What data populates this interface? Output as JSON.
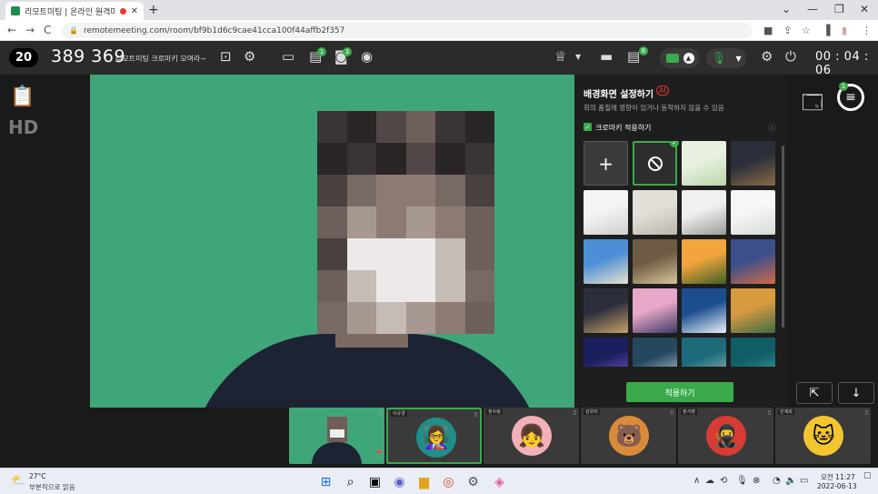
{
  "browser": {
    "tab_title": "리모트미팅 | 온라인 원격미",
    "tab_close": "✕",
    "new_tab": "+",
    "url": "remotemeeting.com/room/bf9b1d6c9cae41cca100f44affb2f357",
    "back": "←",
    "forward": "→",
    "reload": "C"
  },
  "toolbar": {
    "participant_count": "20",
    "room_number": "389 369",
    "room_name": "리모트미팅 크로마키 모여라~",
    "timer": "00 : 04 : 06",
    "badges": {
      "doc": "1",
      "camera": "3",
      "presenter": "6"
    }
  },
  "left_panel": {
    "hd_label": "HD"
  },
  "right_panel": {
    "chat_badge": "1"
  },
  "background_panel": {
    "title": "배경화면 설정하기",
    "ai_badge": "AI",
    "description": "회의 품질에 영향이 있거나 동작하지 않을 수 있음",
    "chroma_key_label": "크로마키 적용하기",
    "chroma_key_checked": true,
    "add_label": "+",
    "apply_button": "적용하기",
    "thumbnails": [
      {
        "type": "add"
      },
      {
        "type": "none",
        "selected": true
      },
      {
        "colors": [
          "#e8f0e2",
          "#b9d6a8"
        ]
      },
      {
        "colors": [
          "#2b2f3a",
          "#8a6a45"
        ]
      },
      {
        "colors": [
          "#f4f4f2",
          "#cfcfcc"
        ]
      },
      {
        "colors": [
          "#e2dfd8",
          "#bcb6aa"
        ]
      },
      {
        "colors": [
          "#f1f0ee",
          "#9a9a98"
        ]
      },
      {
        "colors": [
          "#f6f6f6",
          "#d7dcd8"
        ]
      },
      {
        "colors": [
          "#4d8fd6",
          "#e8e2cf"
        ]
      },
      {
        "colors": [
          "#6e5b43",
          "#d8c49a"
        ]
      },
      {
        "colors": [
          "#f2a53c",
          "#3f5f2a"
        ]
      },
      {
        "colors": [
          "#3b4f8a",
          "#d16a48"
        ]
      },
      {
        "colors": [
          "#2b2f3d",
          "#c7a06a"
        ]
      },
      {
        "colors": [
          "#e7a7c8",
          "#3e3a66"
        ]
      },
      {
        "colors": [
          "#1c4e8f",
          "#e8f1f7"
        ]
      },
      {
        "colors": [
          "#d89a3f",
          "#3e6b46"
        ]
      },
      {
        "colors": [
          "#1b1f5e",
          "#7e5bd0"
        ]
      },
      {
        "colors": [
          "#25485f",
          "#c6d5dd"
        ]
      },
      {
        "colors": [
          "#1d6a7a",
          "#9bc3c8"
        ]
      },
      {
        "colors": [
          "#0f5e63",
          "#3fa0a3"
        ]
      }
    ]
  },
  "participants": [
    {
      "name": "",
      "type": "self"
    },
    {
      "name": "이유경",
      "avatar": "👩‍🏫",
      "color": "#1f8f88",
      "active": true
    },
    {
      "name": "정수림",
      "avatar": "👧",
      "color": "#f3b0b9"
    },
    {
      "name": "김유미",
      "avatar": "🐻",
      "color": "#d98b3a"
    },
    {
      "name": "정서영",
      "avatar": "🥷",
      "color": "#d83a34"
    },
    {
      "name": "민재희",
      "avatar": "🐱",
      "color": "#f2c531"
    }
  ],
  "taskbar": {
    "temp": "27°C",
    "weather": "부분적으로 맑음",
    "time": "오전 11:27",
    "date": "2022-06-13"
  },
  "colors": {
    "accent": "#3aaa4b",
    "chroma": "#3fa67a",
    "dark": "#1e1e1e"
  }
}
